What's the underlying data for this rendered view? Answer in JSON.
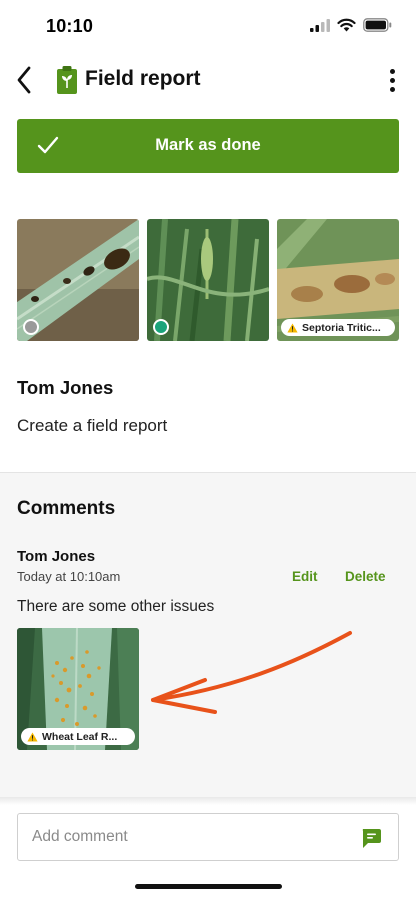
{
  "status_bar": {
    "time": "10:10",
    "icons": [
      "signal-icon",
      "wifi-icon",
      "battery-icon"
    ]
  },
  "header": {
    "title": "Field report",
    "back_icon": "chevron-left-icon",
    "title_icon": "plant-clipboard-icon",
    "menu_icon": "more-vertical-icon"
  },
  "mark_done": {
    "label": "Mark as done",
    "icon": "check-icon",
    "color": "#55941c"
  },
  "photos": [
    {
      "indicator": "grey-dot",
      "dot_color": "#9a9a9a"
    },
    {
      "indicator": "green-dot",
      "dot_color": "#1aa37a"
    },
    {
      "indicator": "warning-tag",
      "tag": "Septoria Tritic..."
    }
  ],
  "report": {
    "author": "Tom Jones",
    "description": "Create a field report"
  },
  "comments": {
    "title": "Comments",
    "items": [
      {
        "author": "Tom Jones",
        "time": "Today at 10:10am",
        "edit_label": "Edit",
        "delete_label": "Delete",
        "text": "There are some other issues",
        "photo_tag": "Wheat Leaf R..."
      }
    ]
  },
  "composer": {
    "placeholder": "Add comment",
    "send_icon": "chat-bubble-icon"
  },
  "colors": {
    "accent": "#55941c",
    "warning": "#f5b800",
    "annotation_arrow": "#e8521a"
  }
}
